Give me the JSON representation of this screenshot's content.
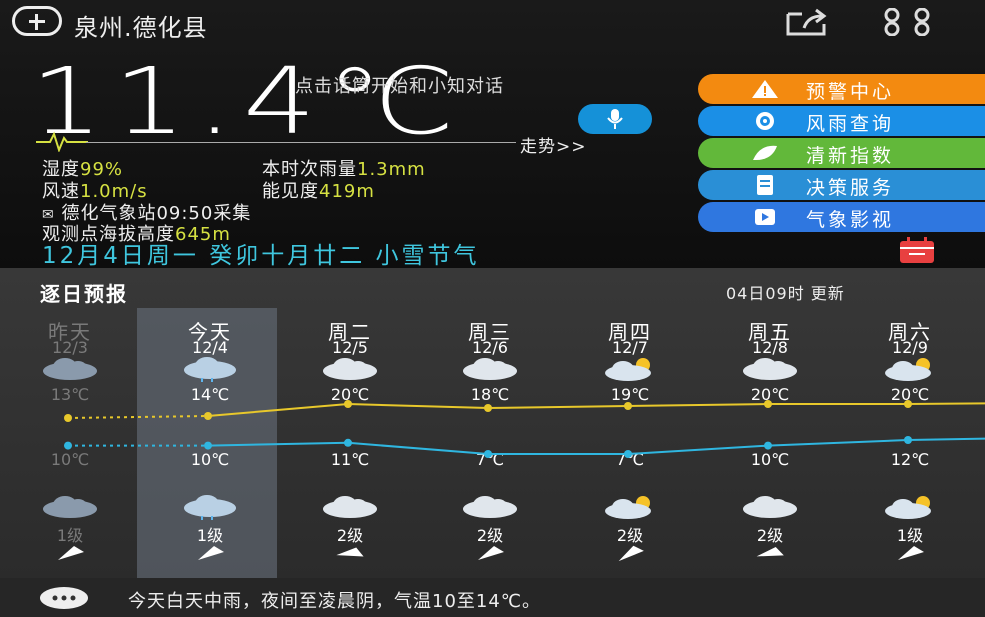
{
  "header": {
    "city": "泉州.德化县",
    "add_icon": "plus-circle-icon",
    "share_icon": "share-icon",
    "grid_icon": "grid-icon"
  },
  "current": {
    "temperature": "11.4℃",
    "talk_hint": "点击话筒开始和小知对话",
    "trend_label": "走势>>",
    "humidity_label": "湿度",
    "humidity_value": "99%",
    "rain_label": "本时次雨量",
    "rain_value": "1.3mm",
    "wind_label": "风速",
    "wind_value": "1.0m/s",
    "visibility_label": "能见度",
    "visibility_value": "419m",
    "station_text": "德化气象站09:50采集",
    "altitude_label": "观测点海拔高度",
    "altitude_value": "645m",
    "date_line": "12月4日周一 癸卯十月廿二 小雪节气"
  },
  "menu": [
    {
      "label": "预警中心",
      "icon": "warning-icon",
      "color": "#f38a10"
    },
    {
      "label": "风雨查询",
      "icon": "radar-icon",
      "color": "#1b8fe6"
    },
    {
      "label": "清新指数",
      "icon": "leaf-icon",
      "color": "#62b83a"
    },
    {
      "label": "决策服务",
      "icon": "document-icon",
      "color": "#2a8fd6"
    },
    {
      "label": "气象影视",
      "icon": "video-icon",
      "color": "#2f77e0"
    }
  ],
  "forecast": {
    "title": "逐日预报",
    "updated": "04日09时 更新",
    "days": [
      {
        "week": "昨天",
        "date": "12/3",
        "high": "13℃",
        "low": "10℃",
        "level": "1级",
        "icon": "cloudy-icon",
        "dim": true
      },
      {
        "week": "今天",
        "date": "12/4",
        "high": "14℃",
        "low": "10℃",
        "level": "1级",
        "icon": "rain-cloud-icon",
        "dim": false
      },
      {
        "week": "周二",
        "date": "12/5",
        "high": "20℃",
        "low": "11℃",
        "level": "2级",
        "icon": "cloudy-icon",
        "dim": false
      },
      {
        "week": "周三",
        "date": "12/6",
        "high": "18℃",
        "low": "7℃",
        "level": "2级",
        "icon": "cloudy-icon",
        "dim": false
      },
      {
        "week": "周四",
        "date": "12/7",
        "high": "19℃",
        "low": "7℃",
        "level": "2级",
        "icon": "partly-sunny-icon",
        "dim": false
      },
      {
        "week": "周五",
        "date": "12/8",
        "high": "20℃",
        "low": "10℃",
        "level": "2级",
        "icon": "cloudy-icon",
        "dim": false
      },
      {
        "week": "周六",
        "date": "12/9",
        "high": "20℃",
        "low": "12℃",
        "level": "1级",
        "icon": "partly-sunny-icon",
        "dim": false
      }
    ],
    "highs": [
      13,
      14,
      20,
      18,
      19,
      20,
      20
    ],
    "lows": [
      10,
      10,
      11,
      7,
      7,
      10,
      12
    ]
  },
  "summary": "今天白天中雨，夜间至凌晨阴，气温10至14℃。"
}
